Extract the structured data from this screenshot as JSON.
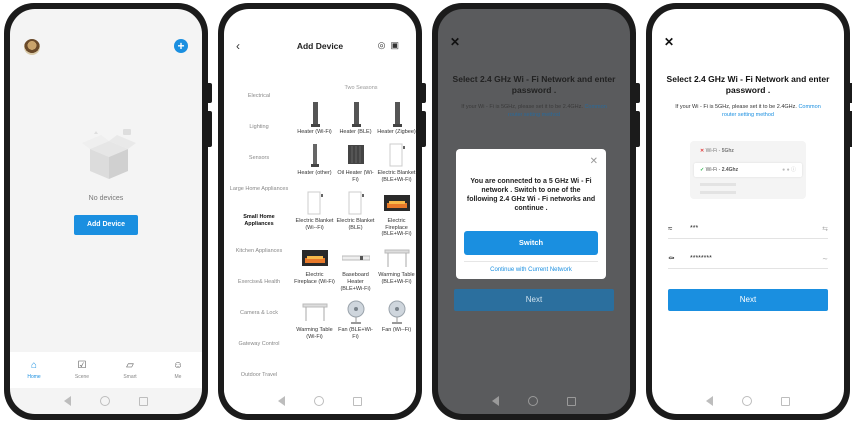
{
  "colors": {
    "accent": "#1a8fe0",
    "dim_overlay": "#5a5b5d",
    "error": "#e23a3a",
    "success": "#2bb34a"
  },
  "phone1": {
    "empty_text": "No devices",
    "add_device_button": "Add Device",
    "tabs": [
      {
        "label": "Home",
        "icon": "home-icon"
      },
      {
        "label": "Scene",
        "icon": "scene-check-icon"
      },
      {
        "label": "Smart",
        "icon": "smart-cube-icon"
      },
      {
        "label": "Me",
        "icon": "user-icon"
      }
    ]
  },
  "phone2": {
    "title": "Add Device",
    "categories": [
      "Electrical",
      "Lighting",
      "Sensors",
      "Large Home Appliances",
      "Small Home Appliances",
      "Kitchen Appliances",
      "Exercise& Health",
      "Camera & Lock",
      "Gateway Control",
      "Outdoor Travel"
    ],
    "active_category": "Small Home Appliances",
    "section_header": "Two Seasons",
    "devices": [
      {
        "label": "Heater (Wi-Fi)",
        "icon": "tower-heater-icon"
      },
      {
        "label": "Heater (BLE)",
        "icon": "tower-heater-icon"
      },
      {
        "label": "Heater (Zigbee)",
        "icon": "tower-heater-icon"
      },
      {
        "label": "Heater (other)",
        "icon": "tower-heater-icon"
      },
      {
        "label": "Oil Heater (Wi-Fi)",
        "icon": "oil-heater-icon"
      },
      {
        "label": "Electric Blanket (BLE+Wi-Fi)",
        "icon": "blanket-icon"
      },
      {
        "label": "Electric Blanket (Wi--Fi)",
        "icon": "blanket-icon"
      },
      {
        "label": "Electric Blanket (BLE)",
        "icon": "blanket-icon"
      },
      {
        "label": "Electric Fireplace (BLE+Wi-Fi)",
        "icon": "fireplace-icon"
      },
      {
        "label": "Electric Fireplace (Wi-Fi)",
        "icon": "fireplace-icon"
      },
      {
        "label": "Baseboard Heater (BLE+Wi-Fi)",
        "icon": "baseboard-heater-icon"
      },
      {
        "label": "Warming Table (BLE+Wi-Fi)",
        "icon": "warming-table-icon"
      },
      {
        "label": "Warming Table (Wi-Fi)",
        "icon": "warming-table-icon"
      },
      {
        "label": "Fan (BLE+Wi-Fi)",
        "icon": "fan-icon"
      },
      {
        "label": "Fan (Wi--Fi)",
        "icon": "fan-icon"
      }
    ]
  },
  "phone3": {
    "title": "Select  2.4 GHz Wi - Fi Network and enter password .",
    "desc": "If your Wi - Fi is 5GHz, please set it to be 2.4GHz.",
    "desc_link": "Common router setting method",
    "dialog_message": "You are connected to a 5 GHz Wi - Fi network . Switch to one of the following 2.4 GHz Wi - Fi networks and continue .",
    "switch_button": "Switch",
    "continue_link": "Continue with Current Network",
    "next_button": "Next"
  },
  "phone4": {
    "title": "Select  2.4 GHz Wi - Fi Network and enter password .",
    "desc": "If your Wi - Fi is 5GHz, please set it to be 2.4GHz.",
    "desc_link": "Common router setting method",
    "wifi_bad_label": "Wi-Fi - ",
    "wifi_bad_band": "5Ghz",
    "wifi_good_label": "Wi-Fi - ",
    "wifi_good_band": "2.4Ghz",
    "ssid_value": "***",
    "password_value": "********",
    "next_button": "Next"
  }
}
